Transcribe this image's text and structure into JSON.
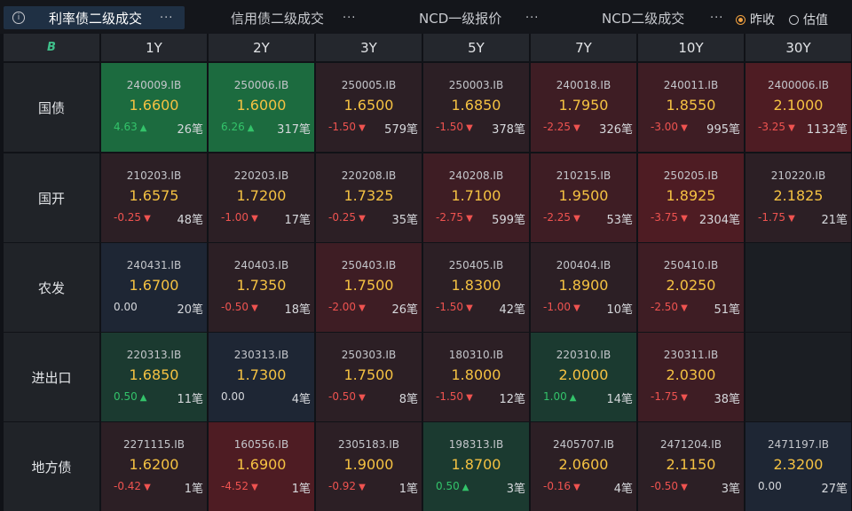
{
  "tabs": [
    {
      "label": "利率债二级成交",
      "active": true
    },
    {
      "label": "信用债二级成交",
      "active": false
    },
    {
      "label": "NCD一级报价",
      "active": false
    },
    {
      "label": "NCD二级成交",
      "active": false
    }
  ],
  "more_glyph": "···",
  "radio": [
    {
      "label": "昨收",
      "selected": true
    },
    {
      "label": "估值",
      "selected": false
    }
  ],
  "corner_logo": "B",
  "tenors": [
    "1Y",
    "2Y",
    "3Y",
    "5Y",
    "7Y",
    "10Y",
    "30Y"
  ],
  "colors": {
    "up_text": "#33c36a",
    "down_text": "#ef5350",
    "yield_text": "#f5c242",
    "green_strong": "#1c6b3f",
    "green_dim": "#1b3a30",
    "red_strong": "#4e1c23",
    "red_mid": "#3e1d24",
    "red_dim": "#2c1f25",
    "neutral": "#1e2634",
    "empty": "#1b1e23"
  },
  "rows": [
    {
      "name": "国债",
      "cells": [
        {
          "code": "240009.IB",
          "yield": "1.6600",
          "change": "4.63",
          "dir": "up",
          "count": "26笔",
          "tone": "green_strong"
        },
        {
          "code": "250006.IB",
          "yield": "1.6000",
          "change": "6.26",
          "dir": "up",
          "count": "317笔",
          "tone": "green_strong"
        },
        {
          "code": "250005.IB",
          "yield": "1.6500",
          "change": "-1.50",
          "dir": "down",
          "count": "579笔",
          "tone": "red_dim"
        },
        {
          "code": "250003.IB",
          "yield": "1.6850",
          "change": "-1.50",
          "dir": "down",
          "count": "378笔",
          "tone": "red_dim"
        },
        {
          "code": "240018.IB",
          "yield": "1.7950",
          "change": "-2.25",
          "dir": "down",
          "count": "326笔",
          "tone": "red_mid"
        },
        {
          "code": "240011.IB",
          "yield": "1.8550",
          "change": "-3.00",
          "dir": "down",
          "count": "995笔",
          "tone": "red_mid"
        },
        {
          "code": "2400006.IB",
          "yield": "2.1000",
          "change": "-3.25",
          "dir": "down",
          "count": "1132笔",
          "tone": "red_strong"
        }
      ]
    },
    {
      "name": "国开",
      "cells": [
        {
          "code": "210203.IB",
          "yield": "1.6575",
          "change": "-0.25",
          "dir": "down",
          "count": "48笔",
          "tone": "red_dim"
        },
        {
          "code": "220203.IB",
          "yield": "1.7200",
          "change": "-1.00",
          "dir": "down",
          "count": "17笔",
          "tone": "red_dim"
        },
        {
          "code": "220208.IB",
          "yield": "1.7325",
          "change": "-0.25",
          "dir": "down",
          "count": "35笔",
          "tone": "red_dim"
        },
        {
          "code": "240208.IB",
          "yield": "1.7100",
          "change": "-2.75",
          "dir": "down",
          "count": "599笔",
          "tone": "red_mid"
        },
        {
          "code": "210215.IB",
          "yield": "1.9500",
          "change": "-2.25",
          "dir": "down",
          "count": "53笔",
          "tone": "red_mid"
        },
        {
          "code": "250205.IB",
          "yield": "1.8925",
          "change": "-3.75",
          "dir": "down",
          "count": "2304笔",
          "tone": "red_strong"
        },
        {
          "code": "210220.IB",
          "yield": "2.1825",
          "change": "-1.75",
          "dir": "down",
          "count": "21笔",
          "tone": "red_dim"
        }
      ]
    },
    {
      "name": "农发",
      "cells": [
        {
          "code": "240431.IB",
          "yield": "1.6700",
          "change": "0.00",
          "dir": "flat",
          "count": "20笔",
          "tone": "neutral"
        },
        {
          "code": "240403.IB",
          "yield": "1.7350",
          "change": "-0.50",
          "dir": "down",
          "count": "18笔",
          "tone": "red_dim"
        },
        {
          "code": "250403.IB",
          "yield": "1.7500",
          "change": "-2.00",
          "dir": "down",
          "count": "26笔",
          "tone": "red_mid"
        },
        {
          "code": "250405.IB",
          "yield": "1.8300",
          "change": "-1.50",
          "dir": "down",
          "count": "42笔",
          "tone": "red_dim"
        },
        {
          "code": "200404.IB",
          "yield": "1.8900",
          "change": "-1.00",
          "dir": "down",
          "count": "10笔",
          "tone": "red_dim"
        },
        {
          "code": "250410.IB",
          "yield": "2.0250",
          "change": "-2.50",
          "dir": "down",
          "count": "51笔",
          "tone": "red_mid"
        },
        null
      ]
    },
    {
      "name": "进出口",
      "cells": [
        {
          "code": "220313.IB",
          "yield": "1.6850",
          "change": "0.50",
          "dir": "up",
          "count": "11笔",
          "tone": "green_dim"
        },
        {
          "code": "230313.IB",
          "yield": "1.7300",
          "change": "0.00",
          "dir": "flat",
          "count": "4笔",
          "tone": "neutral"
        },
        {
          "code": "250303.IB",
          "yield": "1.7500",
          "change": "-0.50",
          "dir": "down",
          "count": "8笔",
          "tone": "red_dim"
        },
        {
          "code": "180310.IB",
          "yield": "1.8000",
          "change": "-1.50",
          "dir": "down",
          "count": "12笔",
          "tone": "red_dim"
        },
        {
          "code": "220310.IB",
          "yield": "2.0000",
          "change": "1.00",
          "dir": "up",
          "count": "14笔",
          "tone": "green_dim"
        },
        {
          "code": "230311.IB",
          "yield": "2.0300",
          "change": "-1.75",
          "dir": "down",
          "count": "38笔",
          "tone": "red_mid"
        },
        null
      ]
    },
    {
      "name": "地方债",
      "cells": [
        {
          "code": "2271115.IB",
          "yield": "1.6200",
          "change": "-0.42",
          "dir": "down",
          "count": "1笔",
          "tone": "red_dim"
        },
        {
          "code": "160556.IB",
          "yield": "1.6900",
          "change": "-4.52",
          "dir": "down",
          "count": "1笔",
          "tone": "red_strong"
        },
        {
          "code": "2305183.IB",
          "yield": "1.9000",
          "change": "-0.92",
          "dir": "down",
          "count": "1笔",
          "tone": "red_dim"
        },
        {
          "code": "198313.IB",
          "yield": "1.8700",
          "change": "0.50",
          "dir": "up",
          "count": "3笔",
          "tone": "green_dim"
        },
        {
          "code": "2405707.IB",
          "yield": "2.0600",
          "change": "-0.16",
          "dir": "down",
          "count": "4笔",
          "tone": "red_dim"
        },
        {
          "code": "2471204.IB",
          "yield": "2.1150",
          "change": "-0.50",
          "dir": "down",
          "count": "3笔",
          "tone": "red_dim"
        },
        {
          "code": "2471197.IB",
          "yield": "2.3200",
          "change": "0.00",
          "dir": "flat",
          "count": "27笔",
          "tone": "neutral"
        }
      ]
    }
  ]
}
